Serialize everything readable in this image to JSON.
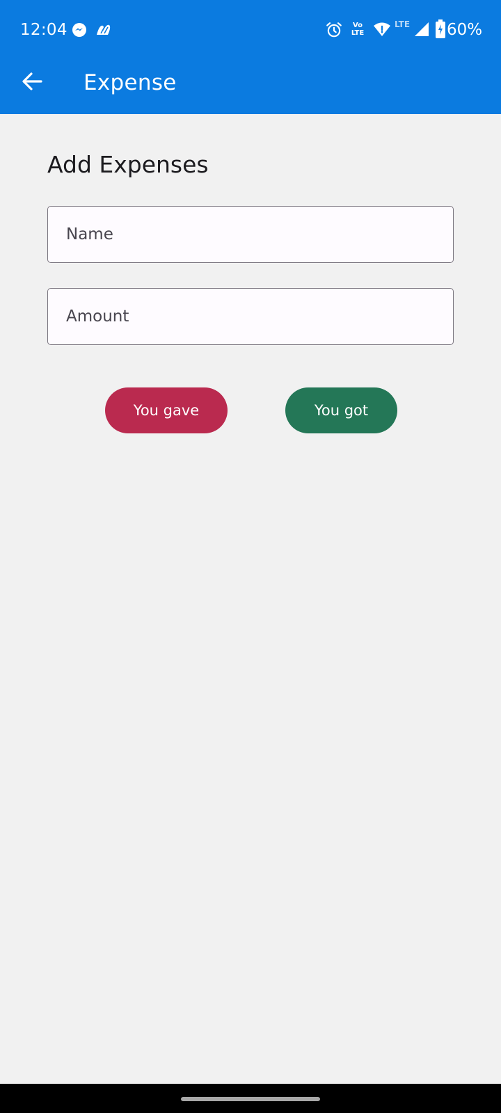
{
  "status_bar": {
    "time": "12:04",
    "volte_label": "Vo LTE",
    "volte_top": "Vo",
    "volte_bottom": "LTE",
    "network_label": "LTE",
    "battery_percent": "60%",
    "icons": [
      "messenger-icon",
      "app-notification-icon",
      "alarm-icon",
      "volte-icon",
      "wifi-icon",
      "cell-signal-icon",
      "battery-icon"
    ]
  },
  "toolbar": {
    "back_icon": "arrow-back-icon",
    "title": "Expense"
  },
  "form": {
    "heading": "Add Expenses",
    "name_field": {
      "placeholder": "Name",
      "value": ""
    },
    "amount_field": {
      "placeholder": "Amount",
      "value": ""
    }
  },
  "actions": {
    "gave_label": "You gave",
    "got_label": "You got"
  },
  "colors": {
    "app_bar": "#0b7be0",
    "background": "#f1f1f1",
    "gave_button": "#ba2a4f",
    "got_button": "#247757",
    "text_primary": "#1c1b1f"
  }
}
